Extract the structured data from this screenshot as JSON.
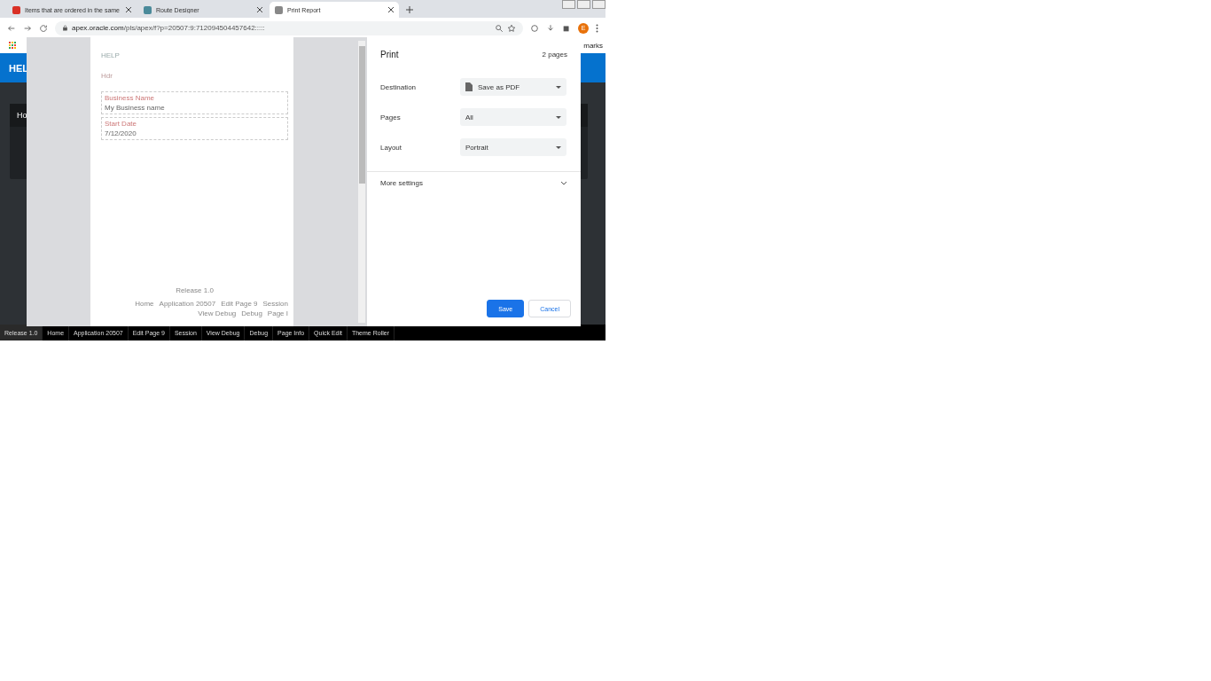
{
  "browser": {
    "tabs": [
      {
        "title": "Items that are ordered in the same",
        "selected": false
      },
      {
        "title": "Route Designer",
        "selected": false
      },
      {
        "title": "Print Report",
        "selected": true
      }
    ],
    "url_host": "apex.oracle.com",
    "url_path": "/pls/apex/f?p=20507:9:712094504457642:::::",
    "profile": "E",
    "bookmarks_right": "marks"
  },
  "app": {
    "header": "HEL",
    "card_title": "Ho",
    "dev_bar": [
      "Release 1.0",
      "Home",
      "Application 20507",
      "Edit Page 9",
      "Session",
      "View Debug",
      "Debug",
      "Page Info",
      "Quick Edit",
      "Theme Roller"
    ]
  },
  "preview": {
    "app_title": "HELP",
    "region_title": "Hdr",
    "fields": [
      {
        "label": "Business Name",
        "value": "My Business name"
      },
      {
        "label": "Start Date",
        "value": "7/12/2020"
      }
    ],
    "footer": "Release 1.0",
    "footer_links": [
      "Home",
      "Application 20507",
      "Edit Page 9",
      "Session",
      "View Debug",
      "Debug",
      "Page I"
    ]
  },
  "print": {
    "title": "Print",
    "pages_count": "2 pages",
    "settings": [
      {
        "label": "Destination",
        "value": "Save as PDF",
        "kind": "pdf"
      },
      {
        "label": "Pages",
        "value": "All",
        "kind": "plain"
      },
      {
        "label": "Layout",
        "value": "Portrait",
        "kind": "plain"
      }
    ],
    "more": "More settings",
    "expanded": false,
    "save": "Save",
    "cancel": "Cancel"
  }
}
